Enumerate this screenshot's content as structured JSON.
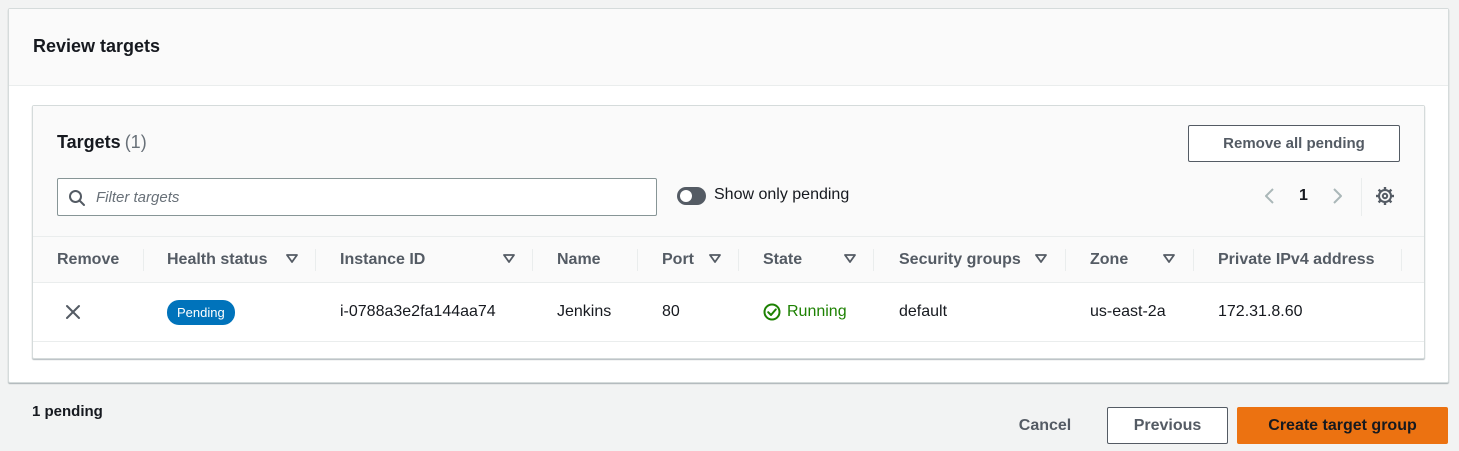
{
  "panel": {
    "title": "Review targets"
  },
  "targets": {
    "title": "Targets",
    "count": "(1)",
    "remove_all_label": "Remove all pending",
    "filter_placeholder": "Filter targets",
    "toggle_label": "Show only pending",
    "page": "1"
  },
  "table": {
    "columns": [
      "Remove",
      "Health status",
      "Instance ID",
      "Name",
      "Port",
      "State",
      "Security groups",
      "Zone",
      "Private IPv4 address"
    ],
    "rows": [
      {
        "health_status": "Pending",
        "instance_id": "i-0788a3e2fa144aa74",
        "name": "Jenkins",
        "port": "80",
        "state": "Running",
        "security_groups": "default",
        "zone": "us-east-2a",
        "private_ipv4": "172.31.8.60"
      }
    ]
  },
  "footer": {
    "pending_text": "1 pending",
    "cancel_label": "Cancel",
    "previous_label": "Previous",
    "create_label": "Create target group"
  },
  "colors": {
    "primary_button": "#ec7211",
    "pending_badge": "#0073bb",
    "running": "#1d8102"
  },
  "icons": [
    "search-icon",
    "chevron-left-icon",
    "chevron-right-icon",
    "settings-icon",
    "sort-down-icon",
    "close-icon",
    "check-circle-icon"
  ]
}
